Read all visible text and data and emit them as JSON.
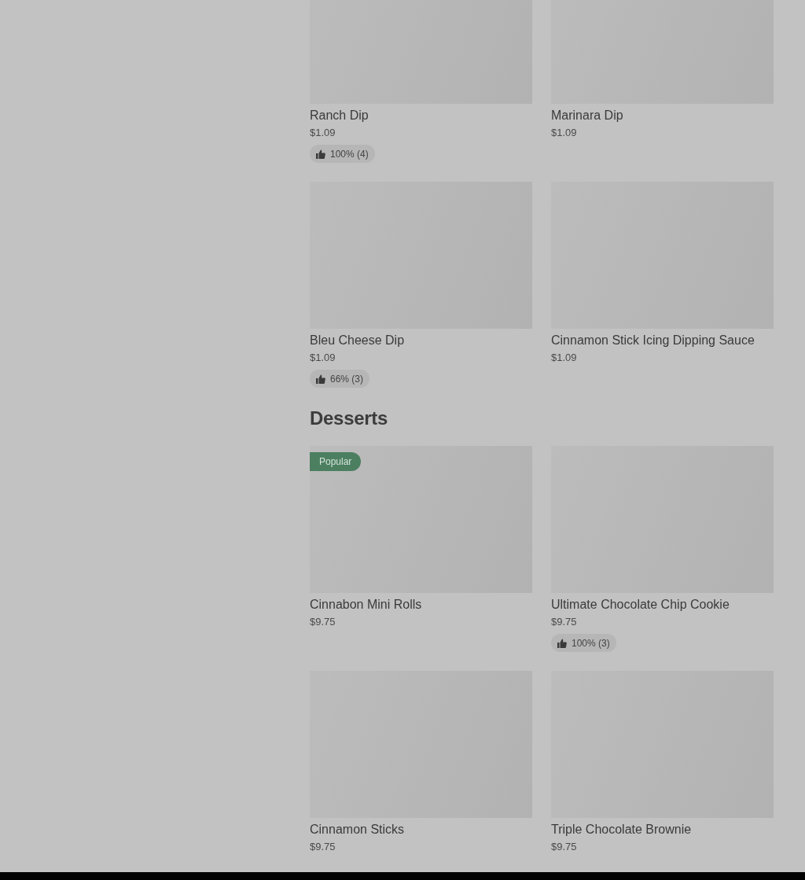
{
  "sections": [
    {
      "items": [
        {
          "name": "Ranch Dip",
          "price": "$1.09",
          "rating": "100% (4)"
        },
        {
          "name": "Marinara Dip",
          "price": "$1.09"
        },
        {
          "name": "Bleu Cheese Dip",
          "price": "$1.09",
          "rating": "66% (3)"
        },
        {
          "name": "Cinnamon Stick Icing Dipping Sauce",
          "price": "$1.09"
        }
      ]
    },
    {
      "heading": "Desserts",
      "items": [
        {
          "name": "Cinnabon Mini Rolls",
          "price": "$9.75",
          "badge": "Popular"
        },
        {
          "name": "Ultimate Chocolate Chip Cookie",
          "price": "$9.75",
          "rating": "100% (3)"
        },
        {
          "name": "Cinnamon Sticks",
          "price": "$9.75"
        },
        {
          "name": "Triple Chocolate Brownie",
          "price": "$9.75"
        }
      ]
    }
  ]
}
